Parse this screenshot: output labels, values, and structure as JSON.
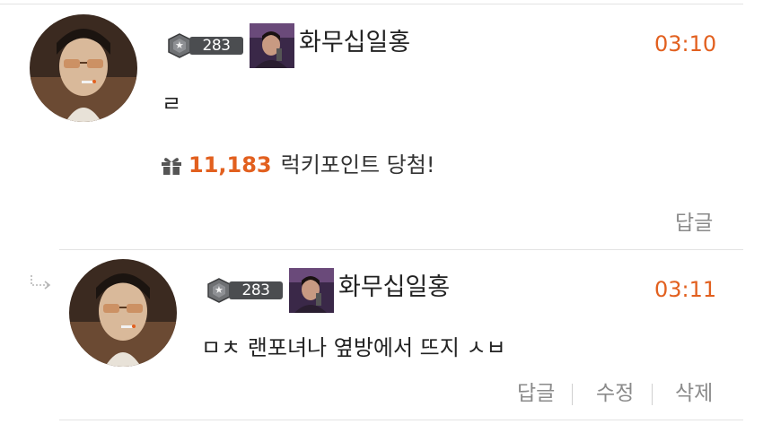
{
  "comments": [
    {
      "level": "283",
      "nickname": "화무십일홍",
      "time": "03:10",
      "text": "ㄹ",
      "lucky": {
        "points": "11,183",
        "label": "럭키포인트 당첨!",
        "icon": "gift-icon"
      },
      "actions": {
        "reply": "답글"
      }
    },
    {
      "is_reply": true,
      "level": "283",
      "nickname": "화무십일홍",
      "time": "03:11",
      "text": "ㅁㅊ 랜포녀나 옆방에서 뜨지 ㅅㅂ",
      "actions": {
        "reply": "답글",
        "edit": "수정",
        "delete": "삭제"
      }
    }
  ],
  "colors": {
    "accent": "#e2601f",
    "text": "#222222",
    "muted": "#8a8a8a",
    "divider": "#e3e3e3",
    "badge": "#4b4d50"
  },
  "icons": [
    "level-medal-icon",
    "gift-icon",
    "reply-arrow-icon"
  ]
}
